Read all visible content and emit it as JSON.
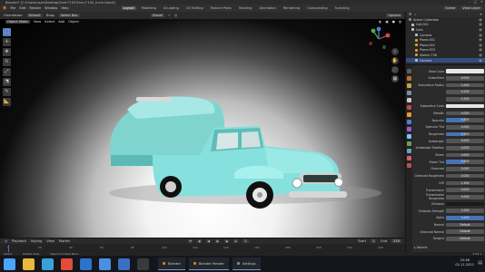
{
  "window": {
    "title": "Blender* [C:\\Users\\user\\Desktop\\Ford F100\\Ford_F100_truck.blend]"
  },
  "menu": {
    "items": [
      "File",
      "Edit",
      "Render",
      "Window",
      "Help"
    ],
    "workspace_tabs": [
      "Layout",
      "Modeling",
      "Sculpting",
      "UV Editing",
      "Texture Paint",
      "Shading",
      "Animation",
      "Rendering",
      "Compositing",
      "Scripting"
    ],
    "active_workspace": "Layout",
    "scene_label": "Scene",
    "view_layer_label": "View Layer"
  },
  "viewport_header": {
    "orientation_label": "Orientation:",
    "orientation_value": "Default",
    "drag_label": "Drag:",
    "drag_value": "Select Box",
    "pivot_value": "Global",
    "options_label": "Options"
  },
  "viewport_subheader": {
    "mode": "Object Mode",
    "items": [
      "View",
      "Select",
      "Add",
      "Object"
    ]
  },
  "outliner": {
    "rows": [
      {
        "label": "Scene Collection",
        "color": "#8a8a8a",
        "selected": false
      },
      {
        "label": "Coll.001",
        "color": "#c4c4c4",
        "selected": false
      },
      {
        "label": "Cars",
        "color": "#c4c4c4",
        "selected": false
      },
      {
        "label": "Camera",
        "color": "#9fc5e8",
        "selected": false
      },
      {
        "label": "Plane.001",
        "color": "#e39b2f",
        "selected": false
      },
      {
        "label": "Plane.002",
        "color": "#e39b2f",
        "selected": false
      },
      {
        "label": "Plane.003",
        "color": "#e39b2f",
        "selected": false
      },
      {
        "label": "Sketch.T38",
        "color": "#e39b2f",
        "selected": false
      },
      {
        "label": "Camera",
        "color": "#9fc5e8",
        "selected": true
      }
    ]
  },
  "properties": {
    "rows": [
      {
        "label": "Base Color",
        "value": "",
        "style": "white"
      },
      {
        "label": "Subsurface",
        "value": "0.000",
        "style": ""
      },
      {
        "label": "Subsurface Radius",
        "value": "1.000",
        "style": ""
      },
      {
        "label": "",
        "value": "0.200",
        "style": ""
      },
      {
        "label": "",
        "value": "0.100",
        "style": ""
      },
      {
        "label": "Subsurface Color",
        "value": "",
        "style": "white"
      },
      {
        "label": "Metallic",
        "value": "0.000",
        "style": ""
      },
      {
        "label": "Specular",
        "value": "0.500",
        "style": "half"
      },
      {
        "label": "Specular Tint",
        "value": "0.000",
        "style": ""
      },
      {
        "label": "Roughness",
        "value": "0.500",
        "style": "half"
      },
      {
        "label": "Anisotropic",
        "value": "0.000",
        "style": ""
      },
      {
        "label": "Anisotropic Rotation",
        "value": "0.000",
        "style": ""
      },
      {
        "label": "Sheen",
        "value": "0.000",
        "style": ""
      },
      {
        "label": "Sheen Tint",
        "value": "0.500",
        "style": "half"
      },
      {
        "label": "Clearcoat",
        "value": "0.000",
        "style": ""
      },
      {
        "label": "Clearcoat Roughness",
        "value": "0.030",
        "style": ""
      },
      {
        "label": "IOR",
        "value": "1.450",
        "style": ""
      },
      {
        "label": "Transmission",
        "value": "0.000",
        "style": ""
      },
      {
        "label": "Transmission Roughness",
        "value": "0.000",
        "style": ""
      },
      {
        "label": "Emission",
        "value": "",
        "style": "dark"
      },
      {
        "label": "Emission Strength",
        "value": "1.000",
        "style": ""
      },
      {
        "label": "Alpha",
        "value": "1.000",
        "style": "blue"
      },
      {
        "label": "Normal",
        "value": "Default",
        "style": ""
      },
      {
        "label": "Clearcoat Normal",
        "value": "Default",
        "style": ""
      },
      {
        "label": "Tangent",
        "value": "Default",
        "style": ""
      }
    ],
    "bottom_label": "Volume"
  },
  "timeline": {
    "items": [
      "Playback",
      "Keying",
      "View",
      "Marker"
    ],
    "current_frame": "1",
    "start_label": "Start",
    "start_value": "1",
    "end_label": "End",
    "end_value": "250",
    "ticks": [
      "0",
      "20",
      "40",
      "60",
      "80",
      "100",
      "120",
      "140",
      "160",
      "180",
      "200",
      "220",
      "240"
    ]
  },
  "statusbar": {
    "left": "Select",
    "middle": "Rotate View",
    "right": "Object Context Menu",
    "version": "2.93.1"
  },
  "taskbar": {
    "icons": [
      {
        "name": "start",
        "color": "#4aa3ff"
      },
      {
        "name": "file-explorer",
        "color": "#e8b83a"
      },
      {
        "name": "edge",
        "color": "#3aa0d8"
      },
      {
        "name": "chrome",
        "color": "#e44b3a"
      },
      {
        "name": "mail",
        "color": "#2c73c9"
      },
      {
        "name": "store",
        "color": "#4a8fe0"
      },
      {
        "name": "photos",
        "color": "#3b6fc4"
      },
      {
        "name": "terminal",
        "color": "#3a3a3a"
      }
    ],
    "windows": [
      "Blender",
      "Blender Render",
      "Settings"
    ],
    "time": "20:46",
    "date": "01.11.2021"
  },
  "colors": {
    "vehicle_body": "#86e0dd",
    "selection_blue": "#334d80",
    "accent": "#4772b3"
  }
}
